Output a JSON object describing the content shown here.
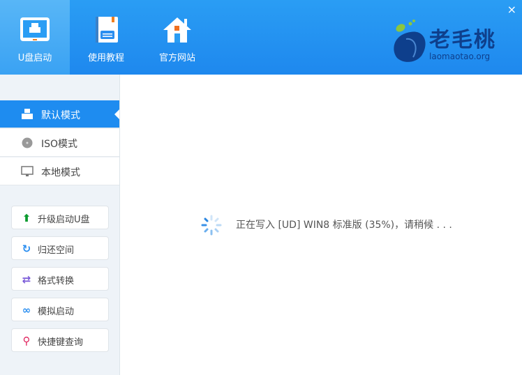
{
  "header": {
    "tabs": [
      {
        "label": "U盘启动",
        "icon": "usb-monitor-icon"
      },
      {
        "label": "使用教程",
        "icon": "book-icon"
      },
      {
        "label": "官方网站",
        "icon": "home-icon"
      }
    ],
    "close": "×",
    "logo": {
      "name": "老毛桃",
      "url": "laomaotao.org"
    }
  },
  "sidebar": {
    "modes": [
      {
        "label": "默认模式"
      },
      {
        "label": "ISO模式"
      },
      {
        "label": "本地模式"
      }
    ],
    "buttons": [
      {
        "label": "升级启动U盘",
        "color": "#0a9a2e"
      },
      {
        "label": "归还空间",
        "color": "#2a8ef0"
      },
      {
        "label": "格式转换",
        "color": "#7a5ad8"
      },
      {
        "label": "模拟启动",
        "color": "#2a8ef0"
      },
      {
        "label": "快捷键查询",
        "color": "#e0245e"
      }
    ]
  },
  "main": {
    "status": "正在写入 [UD] WIN8 标准版 (35%)，请稍候 . . .",
    "progress_percent": 35
  }
}
